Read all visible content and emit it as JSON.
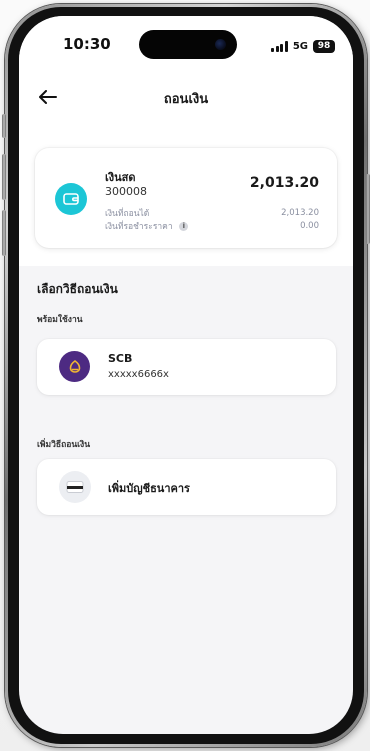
{
  "status_bar": {
    "time": "10:30",
    "network": "5G",
    "battery": "98"
  },
  "header": {
    "title": "ถอนเงิน",
    "back_icon": "back-arrow-icon"
  },
  "balance_card": {
    "account_name": "เงินสด",
    "account_number": "300008",
    "balance": "2,013.20",
    "withdrawable_label": "เงินที่ถอนได้",
    "withdrawable_value": "2,013.20",
    "pending_label": "เงินที่รอชำระราคา",
    "pending_value": "0.00",
    "info_icon": "i",
    "accent": "#1cc6d6"
  },
  "methods": {
    "heading": "เลือกวิธีถอนเงิน",
    "ready_label": "พร้อมใช้งาน",
    "bank": {
      "name": "SCB",
      "account": "xxxxx6666x",
      "brand_color": "#4d2a82"
    },
    "add_label": "เพิ่มวิธีถอนเงิน",
    "add_bank_label": "เพิ่มบัญชีธนาคาร"
  }
}
